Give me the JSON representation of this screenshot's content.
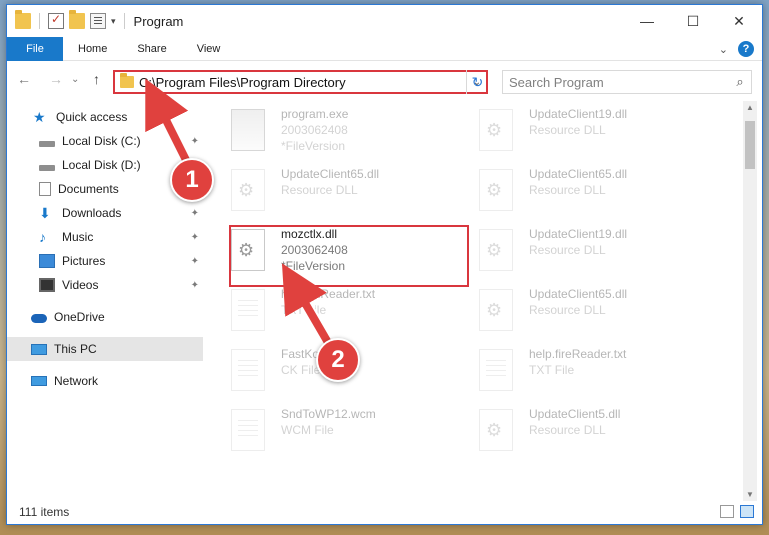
{
  "window": {
    "title": "Program",
    "minimize": "—",
    "maximize": "☐",
    "close": "✕"
  },
  "ribbon": {
    "tabs": [
      "File",
      "Home",
      "Share",
      "View"
    ],
    "expand": "⌄",
    "help": "?"
  },
  "nav": {
    "back": "←",
    "forward": "→",
    "recent": "⌄",
    "up": "↑",
    "address": "C:\\Program Files\\Program Directory",
    "address_dropdown": "⌄",
    "refresh": "↻",
    "search_placeholder": "Search Program",
    "search_icon": "⌕"
  },
  "sidebar": {
    "items": [
      {
        "label": "Quick access",
        "icon": "star-icon"
      },
      {
        "label": "Local Disk (C:)",
        "icon": "drive-icon",
        "pinned": true
      },
      {
        "label": "Local Disk (D:)",
        "icon": "drive-icon"
      },
      {
        "label": "Documents",
        "icon": "documents-icon"
      },
      {
        "label": "Downloads",
        "icon": "download-icon",
        "pinned": true
      },
      {
        "label": "Music",
        "icon": "music-icon",
        "pinned": true
      },
      {
        "label": "Pictures",
        "icon": "pictures-icon",
        "pinned": true
      },
      {
        "label": "Videos",
        "icon": "videos-icon",
        "pinned": true
      },
      {
        "label": "OneDrive",
        "icon": "cloud-icon"
      },
      {
        "label": "This PC",
        "icon": "computer-icon",
        "selected": true
      },
      {
        "label": "Network",
        "icon": "network-icon"
      }
    ],
    "pin_glyph": "📌"
  },
  "files": [
    {
      "name": "program.exe",
      "line2": "2003062408",
      "line3": "*FileVersion",
      "type": "exe"
    },
    {
      "name": "UpdateClient19.dll",
      "line2": "Resource DLL",
      "line3": "",
      "type": "dll"
    },
    {
      "name": "UpdateClient65.dll",
      "line2": "Resource DLL",
      "line3": "",
      "type": "dll"
    },
    {
      "name": "UpdateClient65.dll",
      "line2": "Resource DLL",
      "line3": "",
      "type": "dll"
    },
    {
      "name": "mozctlx.dll",
      "line2": "2003062408",
      "line3": "*FileVersion",
      "type": "dll"
    },
    {
      "name": "UpdateClient19.dll",
      "line2": "Resource DLL",
      "line3": "",
      "type": "dll"
    },
    {
      "name": "hyphenReader.txt",
      "line2": "TXT File",
      "line3": "",
      "type": "txt"
    },
    {
      "name": "UpdateClient65.dll",
      "line2": "Resource DLL",
      "line3": "",
      "type": "dll"
    },
    {
      "name": "FastKo",
      "line2": "CK File",
      "line3": "",
      "type": "txt"
    },
    {
      "name": "help.fireReader.txt",
      "line2": "TXT File",
      "line3": "",
      "type": "txt"
    },
    {
      "name": "SndToWP12.wcm",
      "line2": "WCM File",
      "line3": "",
      "type": "txt"
    },
    {
      "name": "UpdateClient5.dll",
      "line2": "Resource DLL",
      "line3": "",
      "type": "dll"
    }
  ],
  "status": {
    "count": "111 items"
  },
  "annotations": {
    "step1": "1",
    "step2": "2",
    "color": "#e0413e"
  }
}
